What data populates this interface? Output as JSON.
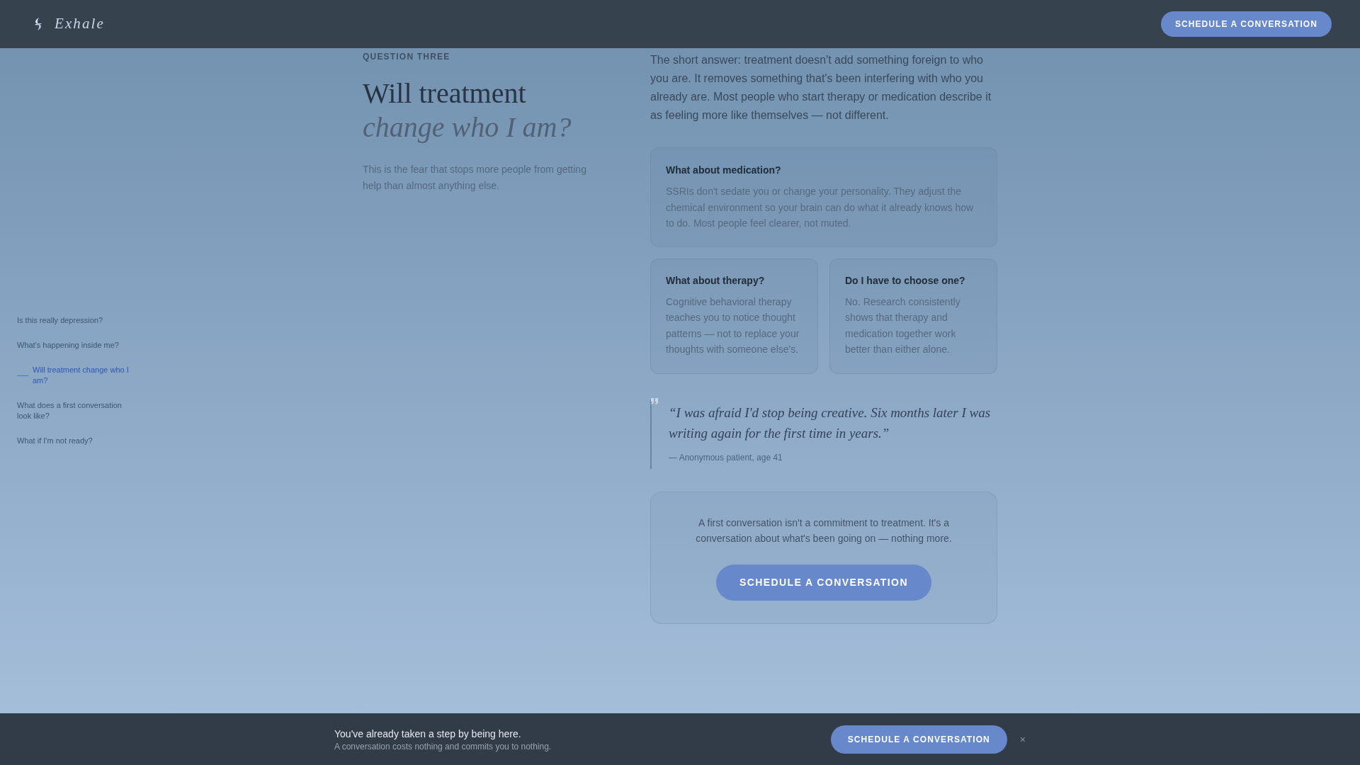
{
  "header": {
    "logo": "Exhale",
    "button": "SCHEDULE A CONVERSATION"
  },
  "side_nav": [
    {
      "label": "Is this really depression?",
      "selected": false
    },
    {
      "label": "What's happening inside me?",
      "selected": false
    },
    {
      "label": "Will treatment change who I am?",
      "selected": true
    },
    {
      "label": "What does a first conversation look like?",
      "selected": false
    },
    {
      "label": "What if I'm not ready?",
      "selected": false
    }
  ],
  "question": {
    "eyebrow": "QUESTION THREE",
    "title": "Will treatment",
    "title_italic": "change who I am?",
    "subtitle": "This is the fear that stops more people from getting help than almost anything else."
  },
  "answer": {
    "intro": "The short answer: treatment doesn't add something foreign to who you are. It removes something that's been interfering with who you already are. Most people who start therapy or medication describe it as feeling more like themselves — not different.",
    "cards": [
      {
        "title": "What about medication?",
        "body": "SSRIs don't sedate you or change your personality. They adjust the chemical environment so your brain can do what it already knows how to do. Most people feel clearer, not muted."
      },
      {
        "title": "What about therapy?",
        "body": "Cognitive behavioral therapy teaches you to notice thought patterns — not to replace your thoughts with someone else's."
      },
      {
        "title": "Do I have to choose one?",
        "body": "No. Research consistently shows that therapy and medication together work better than either alone."
      }
    ],
    "quote": {
      "text": "“I was afraid I'd stop being creative. Six months later I was writing again for the first time in years.”",
      "attribution": "— Anonymous patient, age 41"
    },
    "cta": {
      "text": "A first conversation isn't a commitment to treatment. It's a conversation about what's been going on — nothing more.",
      "button": "SCHEDULE A CONVERSATION"
    }
  },
  "bottom_bar": {
    "title": "You've already taken a step by being here.",
    "subtitle": "A conversation costs nothing and commits you to nothing.",
    "button": "SCHEDULE A CONVERSATION",
    "close": "×"
  }
}
